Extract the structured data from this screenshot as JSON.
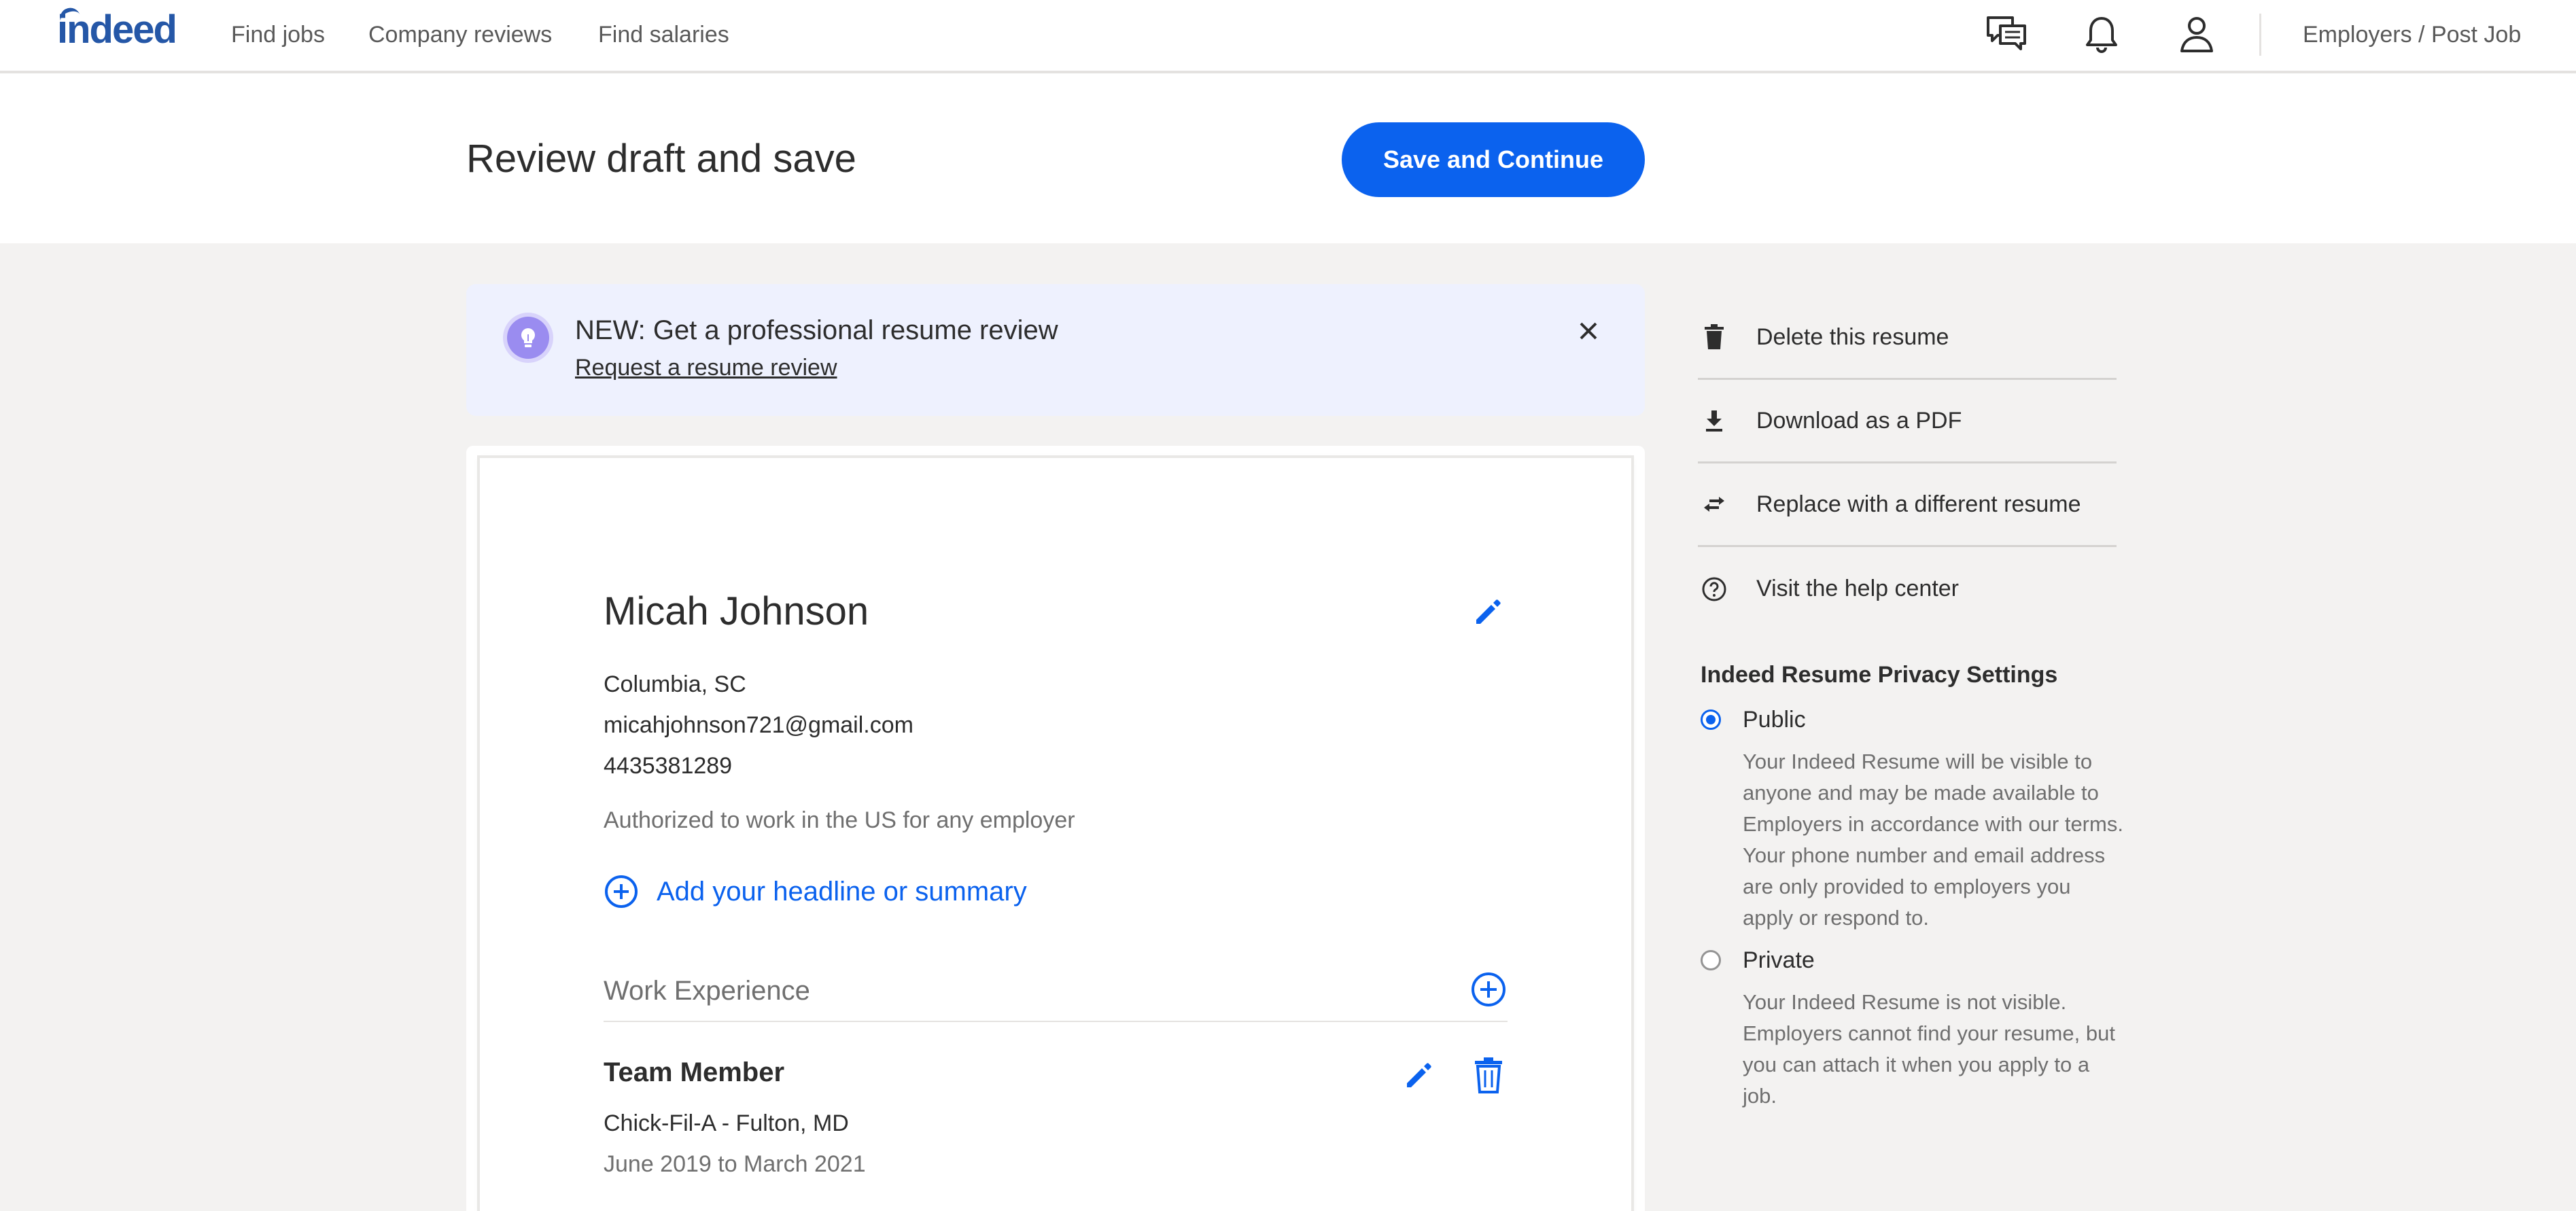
{
  "nav": {
    "logo": "indeed",
    "links": [
      "Find jobs",
      "Company reviews",
      "Find salaries"
    ],
    "icons": [
      "messages-icon",
      "notifications-bell-icon",
      "account-user-icon"
    ],
    "employers": "Employers / Post Job"
  },
  "header": {
    "title": "Review draft and save",
    "save_label": "Save and Continue"
  },
  "promo": {
    "title": "NEW: Get a professional resume review",
    "link": "Request a resume review",
    "icon": "lightbulb-icon",
    "accent": "#9a8cf0"
  },
  "resume": {
    "name": "Micah Johnson",
    "location": "Columbia, SC",
    "email": "micahjohnson721@gmail.com",
    "phone": "4435381289",
    "authorization": "Authorized to work in the US for any employer",
    "add_headline": "Add your headline or summary",
    "work_section_title": "Work Experience",
    "jobs": [
      {
        "title": "Team Member",
        "company": "Chick-Fil-A - Fulton, MD",
        "dates": "June 2019 to March 2021"
      }
    ]
  },
  "side_actions": [
    {
      "label": "Delete this resume",
      "icon": "trash-icon"
    },
    {
      "label": "Download as a PDF",
      "icon": "download-icon"
    },
    {
      "label": "Replace with a different resume",
      "icon": "swap-arrows-icon"
    },
    {
      "label": "Visit the help center",
      "icon": "help-circle-icon"
    }
  ],
  "privacy": {
    "title": "Indeed Resume Privacy Settings",
    "selected": "Public",
    "options": [
      {
        "label": "Public",
        "description": "Your Indeed Resume will be visible to anyone and may be made available to Employers in accordance with our terms. Your phone number and email address are only provided to employers you apply or respond to."
      },
      {
        "label": "Private",
        "description": "Your Indeed Resume is not visible. Employers cannot find your resume, but you can attach it when you apply to a job."
      }
    ]
  },
  "colors": {
    "brand": "#2557a7",
    "primary_button": "#0b62ee",
    "link": "#0b62ee",
    "banner_bg": "#eef1fe",
    "page_bg": "#f3f2f1"
  }
}
